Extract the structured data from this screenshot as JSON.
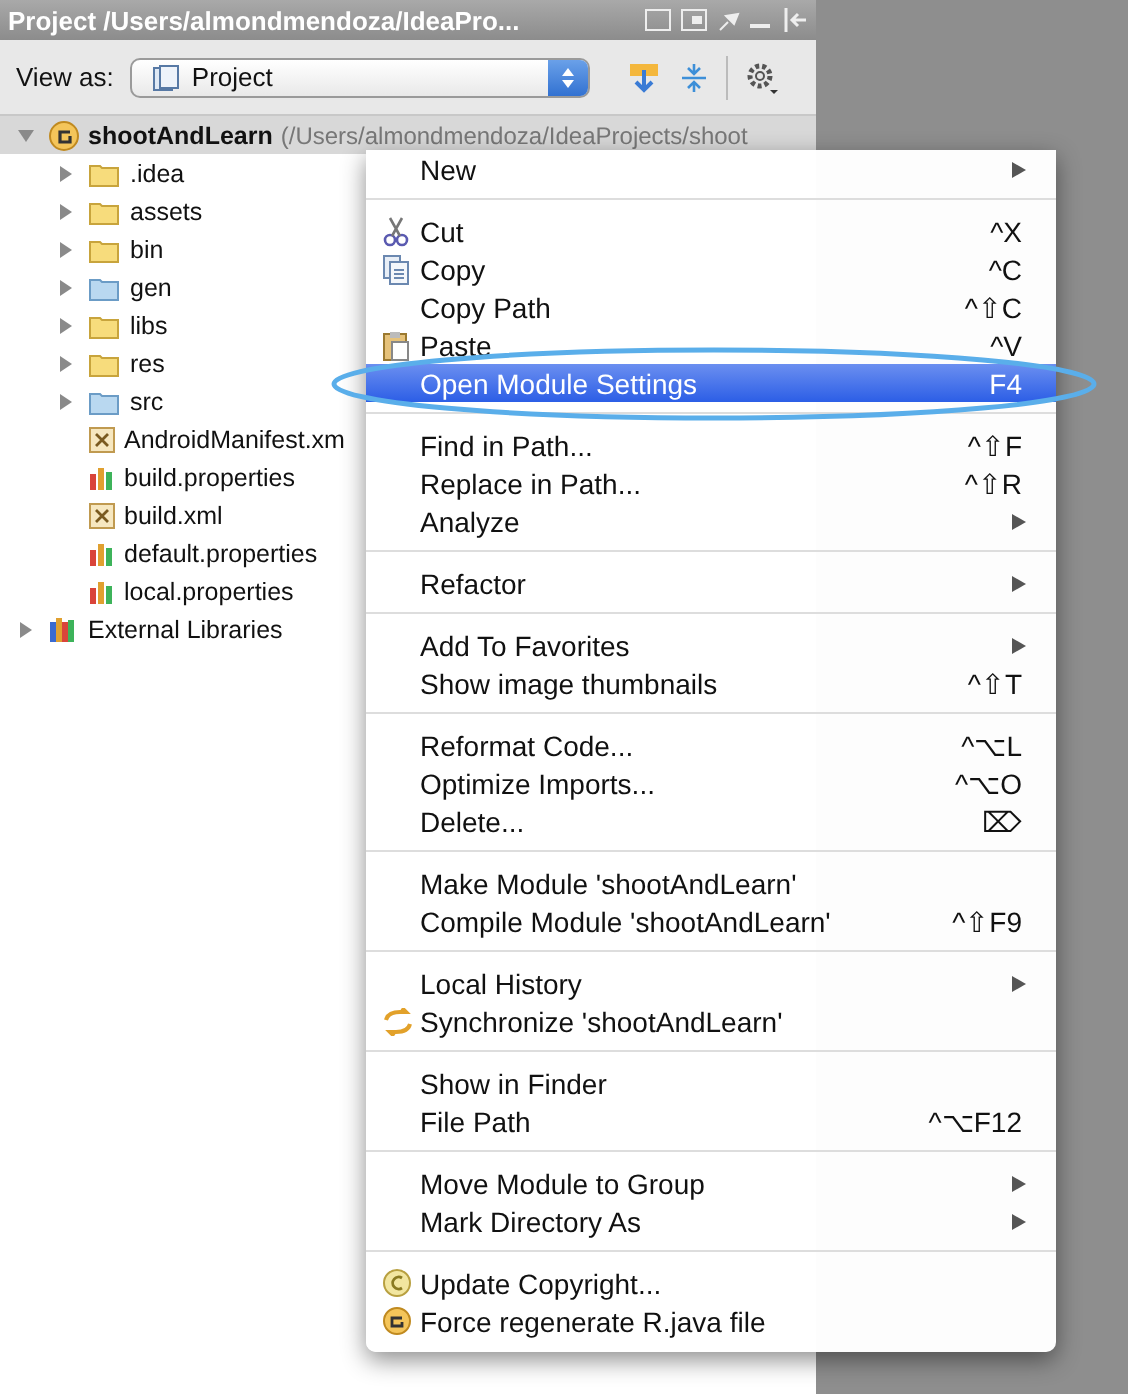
{
  "panel": {
    "title": "Project /Users/almondmendoza/IdeaPro...",
    "view_as_label": "View as:",
    "view_as_value": "Project"
  },
  "tree": [
    {
      "kind": "module",
      "label": "shootAndLearn",
      "path": "(/Users/almondmendoza/IdeaProjects/shoot",
      "expanded": true,
      "selected": true,
      "children": [
        {
          "kind": "folder",
          "label": ".idea",
          "expanded": false,
          "selected": false
        },
        {
          "kind": "folder",
          "label": "assets",
          "expanded": false,
          "selected": false
        },
        {
          "kind": "folder",
          "label": "bin",
          "expanded": false,
          "selected": false
        },
        {
          "kind": "source_folder",
          "label": "gen",
          "expanded": false,
          "selected": false
        },
        {
          "kind": "folder",
          "label": "libs",
          "expanded": false,
          "selected": false
        },
        {
          "kind": "folder",
          "label": "res",
          "expanded": false,
          "selected": false
        },
        {
          "kind": "source_folder",
          "label": "src",
          "expanded": false,
          "selected": false
        },
        {
          "kind": "xml_file",
          "label": "AndroidManifest.xm",
          "selected": false
        },
        {
          "kind": "properties_file",
          "label": "build.properties",
          "selected": false
        },
        {
          "kind": "xml_file",
          "label": "build.xml",
          "selected": false
        },
        {
          "kind": "properties_file",
          "label": "default.properties",
          "selected": false
        },
        {
          "kind": "properties_file",
          "label": "local.properties",
          "selected": false
        }
      ]
    },
    {
      "kind": "library",
      "label": "External Libraries",
      "expanded": false,
      "selected": false
    }
  ],
  "context_menu": [
    [
      {
        "label": "New",
        "submenu": true,
        "selected": false
      }
    ],
    [
      {
        "label": "Cut",
        "shortcut": "^X",
        "selected": false
      },
      {
        "label": "Copy",
        "shortcut": "^C",
        "selected": false
      },
      {
        "label": "Copy Path",
        "shortcut": "^⇧C",
        "selected": false
      },
      {
        "label": "Paste",
        "shortcut": "^V",
        "selected": false
      },
      {
        "label": "Open Module Settings",
        "shortcut": "F4",
        "selected": true
      }
    ],
    [
      {
        "label": "Find in Path...",
        "shortcut": "^⇧F",
        "selected": false
      },
      {
        "label": "Replace in Path...",
        "shortcut": "^⇧R",
        "selected": false
      },
      {
        "label": "Analyze",
        "submenu": true,
        "selected": false
      }
    ],
    [
      {
        "label": "Refactor",
        "submenu": true,
        "selected": false
      }
    ],
    [
      {
        "label": "Add To Favorites",
        "submenu": true,
        "selected": false
      },
      {
        "label": "Show image thumbnails",
        "shortcut": "^⇧T",
        "selected": false
      }
    ],
    [
      {
        "label": "Reformat Code...",
        "shortcut": "^⌥L",
        "selected": false
      },
      {
        "label": "Optimize Imports...",
        "shortcut": "^⌥O",
        "selected": false
      },
      {
        "label": "Delete...",
        "shortcut": "⌦",
        "selected": false
      }
    ],
    [
      {
        "label": "Make Module 'shootAndLearn'",
        "selected": false
      },
      {
        "label": "Compile Module 'shootAndLearn'",
        "shortcut": "^⇧F9",
        "selected": false
      }
    ],
    [
      {
        "label": "Local History",
        "submenu": true,
        "selected": false
      },
      {
        "label": "Synchronize 'shootAndLearn'",
        "selected": false
      }
    ],
    [
      {
        "label": "Show in Finder",
        "selected": false
      },
      {
        "label": "File Path",
        "shortcut": "^⌥F12",
        "selected": false
      }
    ],
    [
      {
        "label": "Move Module to Group",
        "submenu": true,
        "selected": false
      },
      {
        "label": "Mark Directory As",
        "submenu": true,
        "selected": false
      }
    ],
    [
      {
        "label": "Update Copyright...",
        "selected": false
      },
      {
        "label": "Force regenerate R.java file",
        "selected": false
      }
    ]
  ]
}
